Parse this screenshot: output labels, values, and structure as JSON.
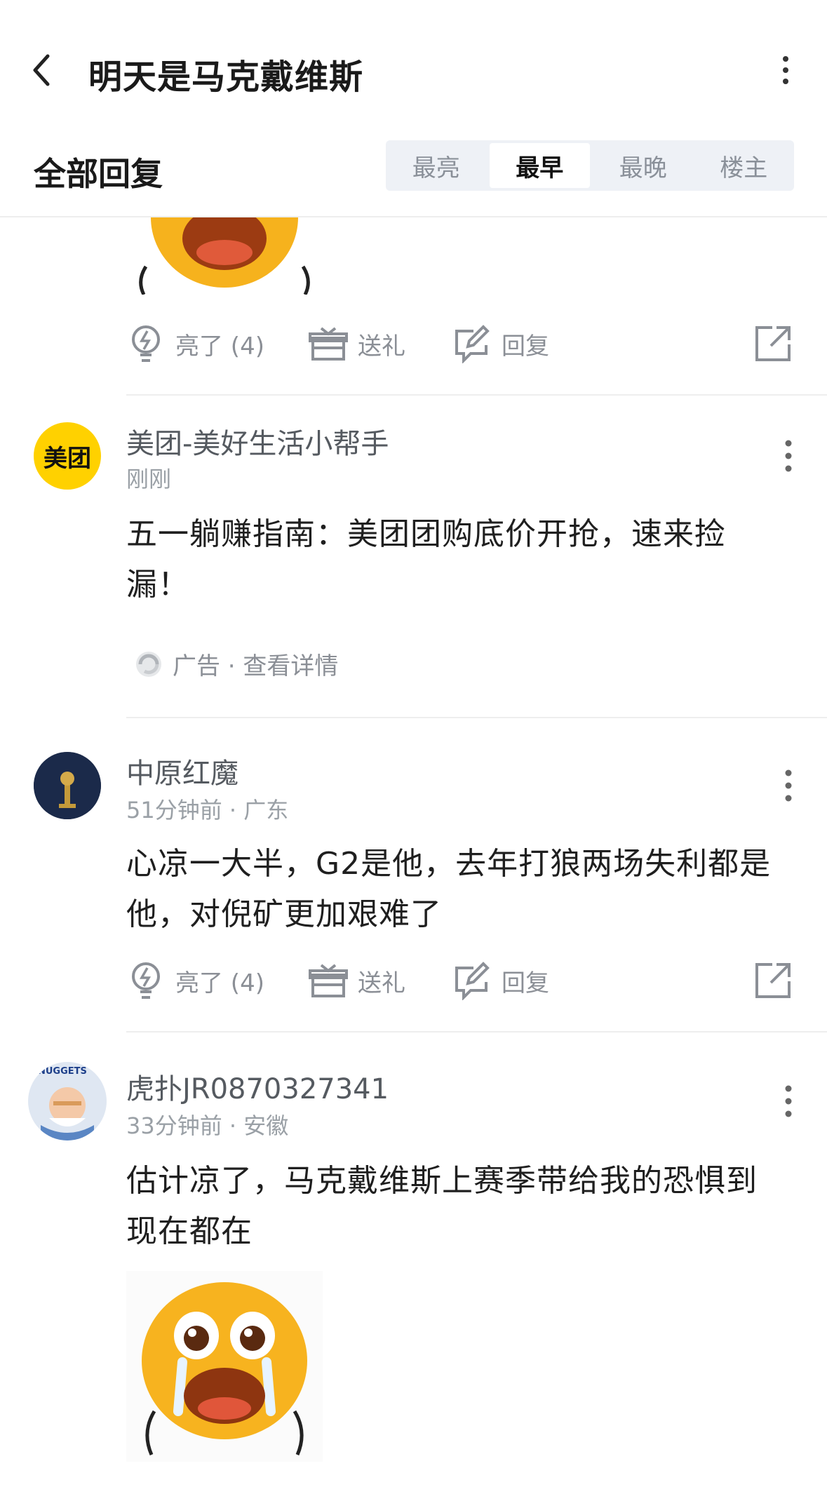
{
  "header": {
    "title": "明天是马克戴维斯"
  },
  "tabs": {
    "section_title": "全部回复",
    "items": [
      "最亮",
      "最早",
      "最晚",
      "楼主"
    ],
    "active_index": 1
  },
  "actions": {
    "light_label": "亮了 (4)",
    "gift_label": "送礼",
    "reply_label": "回复"
  },
  "ad": {
    "avatar_text": "美团",
    "username": "美团-美好生活小帮手",
    "time": "刚刚",
    "text": "五一躺赚指南：美团团购底价开抢，速来捡漏！",
    "ad_label": "广告 · 查看详情"
  },
  "comments": [
    {
      "username": "中原红魔",
      "meta": "51分钟前 · 广东",
      "text": "心凉一大半，G2是他，去年打狼两场失利都是他，对倪矿更加艰难了"
    },
    {
      "username": "虎扑JR0870327341",
      "meta": "33分钟前 · 安徽",
      "text": "估计凉了，马克戴维斯上赛季带给我的恐惧到现在都在",
      "avatar_badge": "NUGGETS"
    }
  ],
  "colors": {
    "meituan_yellow": "#FFD100",
    "accent_gray": "#8b8f96",
    "segment_bg": "#eef1f6"
  },
  "icons": [
    "back-arrow-icon",
    "more-vertical-icon",
    "lightbulb-icon",
    "gift-icon",
    "reply-edit-icon",
    "share-external-icon",
    "ad-logo-icon",
    "crying-emoji-sticker"
  ]
}
